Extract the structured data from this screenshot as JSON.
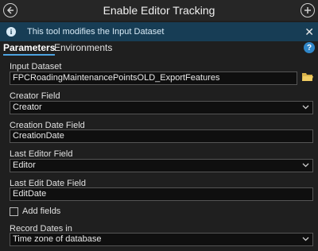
{
  "header": {
    "title": "Enable Editor Tracking",
    "back_icon": "back-arrow-icon",
    "add_icon": "plus-circle-icon"
  },
  "info": {
    "message": "This tool modifies the Input Dataset",
    "icon": "info-icon",
    "close_icon": "close-icon",
    "bg_color": "#173d55"
  },
  "tabs": {
    "parameters": "Parameters",
    "environments": "Environments",
    "help_icon": "help-icon",
    "active_color": "#4da3e0"
  },
  "form": {
    "input_dataset": {
      "label": "Input Dataset",
      "value": "FPCRoadingMaintenancePointsOLD_ExportFeatures",
      "icon": "folder-icon"
    },
    "creator_field": {
      "label": "Creator Field",
      "value": "Creator"
    },
    "creation_date_field": {
      "label": "Creation Date Field",
      "value": "CreationDate"
    },
    "last_editor_field": {
      "label": "Last Editor Field",
      "value": "Editor"
    },
    "last_edit_date_field": {
      "label": "Last Edit Date Field",
      "value": "EditDate"
    },
    "add_fields": {
      "label": "Add fields",
      "checked": false
    },
    "record_dates_in": {
      "label": "Record Dates in",
      "value": "Time zone of database"
    }
  }
}
